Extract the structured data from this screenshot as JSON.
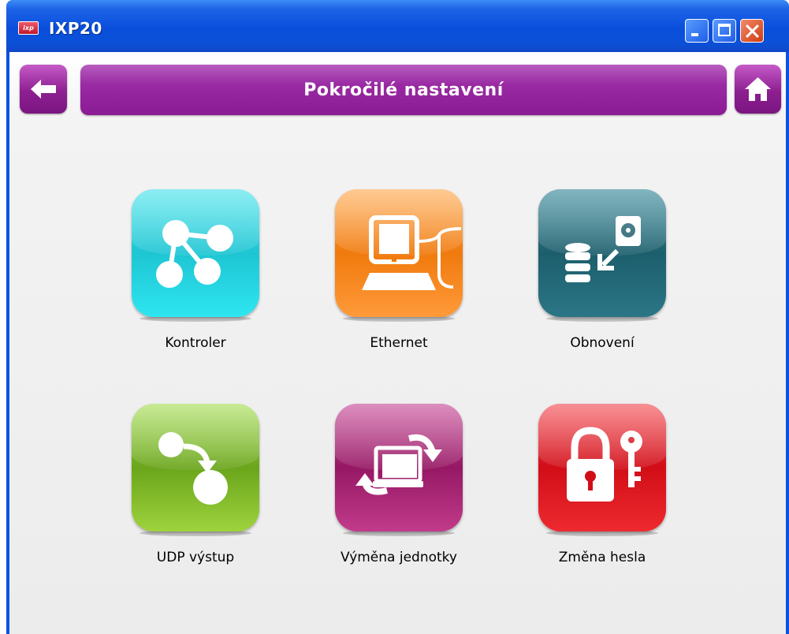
{
  "window": {
    "title": "IXP20",
    "app_icon_text": "ixp",
    "controls": [
      "minimize-icon",
      "maximize-icon",
      "close-icon"
    ]
  },
  "header": {
    "title": "Pokročilé nastavení",
    "back_icon": "arrow-left-icon",
    "home_icon": "home-icon"
  },
  "tiles": [
    {
      "label": "Kontroler",
      "icon": "network-nodes-icon",
      "color": "#1ec5d3"
    },
    {
      "label": "Ethernet",
      "icon": "computer-icon",
      "color": "#f07a0d"
    },
    {
      "label": "Obnovení",
      "icon": "database-restore-icon",
      "color": "#1c5e6c"
    },
    {
      "label": "UDP výstup",
      "icon": "udp-output-icon",
      "color": "#6aa51b"
    },
    {
      "label": "Výměna jednotky",
      "icon": "device-swap-icon",
      "color": "#961864"
    },
    {
      "label": "Změna hesla",
      "icon": "lock-key-icon",
      "color": "#d10d17"
    }
  ],
  "colors": {
    "accent": "#9a2aa3",
    "titlebar": "#0a4fdc"
  }
}
